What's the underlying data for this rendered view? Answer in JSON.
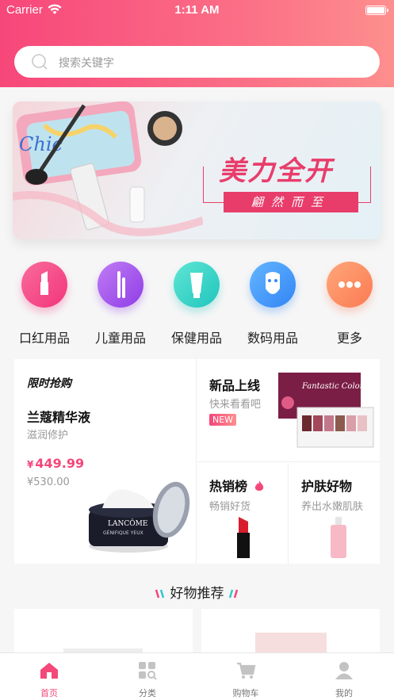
{
  "status_bar": {
    "carrier": "Carrier",
    "time": "1:11 AM"
  },
  "search": {
    "placeholder": "搜索关键字"
  },
  "banner": {
    "title": "美力全开",
    "subtitle": "翩然而至",
    "brand_text": "Chic"
  },
  "categories": [
    {
      "label": "口红用品",
      "icon": "lipstick-icon",
      "color_from": "#f96b9b",
      "color_to": "#f2357a"
    },
    {
      "label": "儿童用品",
      "icon": "mascara-icon",
      "color_from": "#c07cf4",
      "color_to": "#8f3de6"
    },
    {
      "label": "保健用品",
      "icon": "tube-icon",
      "color_from": "#5fe6d4",
      "color_to": "#20c5bd"
    },
    {
      "label": "数码用品",
      "icon": "face-mask-icon",
      "color_from": "#63b6ff",
      "color_to": "#3385f5"
    },
    {
      "label": "更多",
      "icon": "more-icon",
      "color_from": "#ffa77a",
      "color_to": "#fb7a52"
    }
  ],
  "promo": {
    "flash_label": "限时抢购",
    "main": {
      "title": "兰蔻精华液",
      "subtitle": "滋润修护",
      "currency": "¥",
      "price": "449.99",
      "old_price": "¥530.00",
      "product_brand": "LANCÔME",
      "product_name": "GÉNIFIQUE YEUX"
    },
    "new": {
      "title": "新品上线",
      "subtitle": "快来看看吧",
      "badge": "NEW",
      "palette_text": "Fantastic Color Eyes"
    },
    "hot": {
      "title": "热销榜",
      "subtitle": "畅销好货"
    },
    "skin": {
      "title": "护肤好物",
      "subtitle": "养出水嫩肌肤"
    }
  },
  "recommend": {
    "title": "好物推荐"
  },
  "tabbar": [
    {
      "label": "首页",
      "icon": "home-icon",
      "active": true
    },
    {
      "label": "分类",
      "icon": "category-icon",
      "active": false
    },
    {
      "label": "购物车",
      "icon": "cart-icon",
      "active": false
    },
    {
      "label": "我的",
      "icon": "user-icon",
      "active": false
    }
  ],
  "colors": {
    "accent": "#f4477a",
    "header_from": "#f7477a",
    "header_to": "#fd8f8e"
  }
}
